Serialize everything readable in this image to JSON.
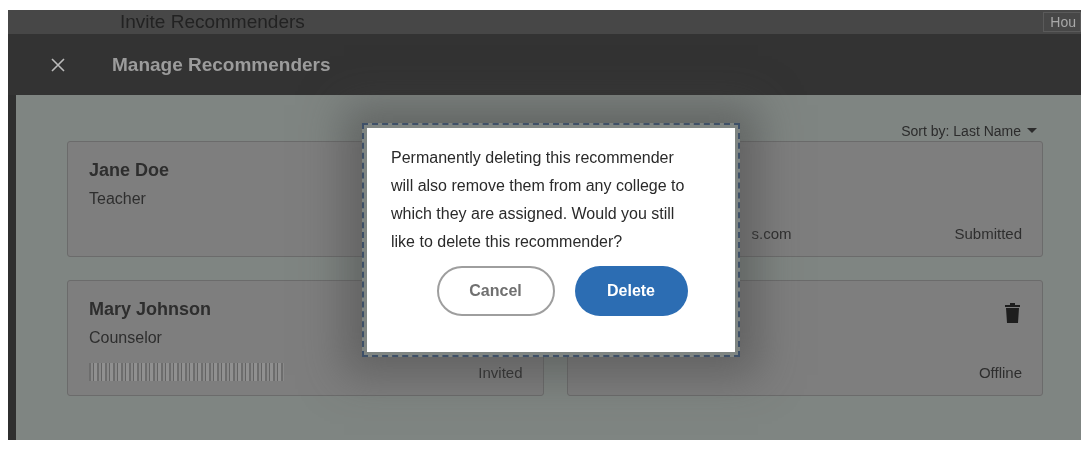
{
  "background_page": {
    "title": "Invite Recommenders",
    "button": "Hou"
  },
  "header": {
    "title": "Manage Recommenders"
  },
  "sort": {
    "label": "Sort by: Last Name"
  },
  "recommenders": [
    {
      "name": "Jane Doe",
      "role": "Teacher",
      "delete_icon": false
    },
    {
      "email": "s.com",
      "status": "Submitted",
      "delete_icon": false
    },
    {
      "name": "Mary Johnson",
      "role": "Counselor",
      "email_redacted": true,
      "status": "Invited",
      "delete_icon": false
    },
    {
      "status": "Offline",
      "delete_icon": true
    }
  ],
  "dialog": {
    "message": "Permanently deleting this recommender will also remove them from any college to which they are assigned. Would you still like to delete this recommender?",
    "buttons": [
      {
        "label": "Cancel",
        "kind": "secondary"
      },
      {
        "label": "Delete",
        "kind": "primary"
      }
    ]
  }
}
